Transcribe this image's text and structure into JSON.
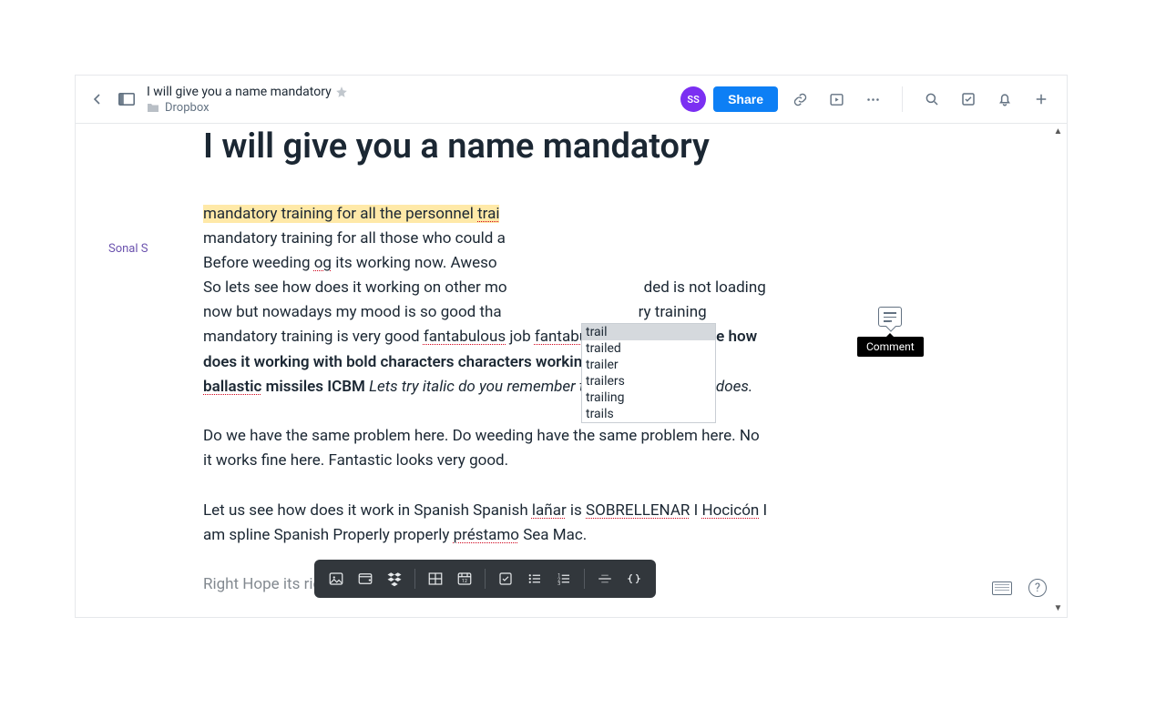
{
  "header": {
    "doc_title": "I will give you a name mandatory",
    "breadcrumb": "Dropbox",
    "share_label": "Share",
    "avatar_initials": "SS"
  },
  "page": {
    "heading": "I will give you a name mandatory",
    "author": "Sonal S",
    "highlight_line": "mandatory training for all the personnel ",
    "highlight_tail": "trai",
    "p1_a": "mandatory training for all those who could a",
    "p1_b": "Before weeding ",
    "p1_og": "og",
    "p1_c": " its working now. Aweso",
    "p2_a": "So lets see how does it working on other mo",
    "p2_b": "ded is not loading now but nowadays my mood is so good tha",
    "p2_c": "ry training mandatory training is very good ",
    "fant": "fantabulous",
    "p2_d": " job ",
    "p2_e": " job ",
    "bold1": "now let see how does it working with bold characters characters working does ICBM inter ",
    "bold2": "ballastic",
    "bold3": " missiles ICBM",
    "ital": " Lets try italic do you remember the word italic yes it does.",
    "p3": "Do we have the same problem here. Do weeding have the same problem here. No it works fine here. Fantastic looks very good.",
    "p4_a": "Let us see how does it work in Spanish Spanish ",
    "p4_lanar": "lañar",
    "p4_b": " is ",
    "p4_sob": "SOBRELLENAR",
    "p4_c": " I ",
    "p4_hoc": "Hocicón",
    "p4_d": " I am spline Spanish Properly properly ",
    "p4_pre": "préstamo",
    "p4_e": " Sea Mac.",
    "p5": "Right Hope its right I said I Hope."
  },
  "autocomplete": {
    "items": [
      "trail",
      "trailed",
      "trailer",
      "trailers",
      "trailing",
      "trails"
    ],
    "selected_index": 0
  },
  "tooltip": {
    "comment": "Comment"
  }
}
